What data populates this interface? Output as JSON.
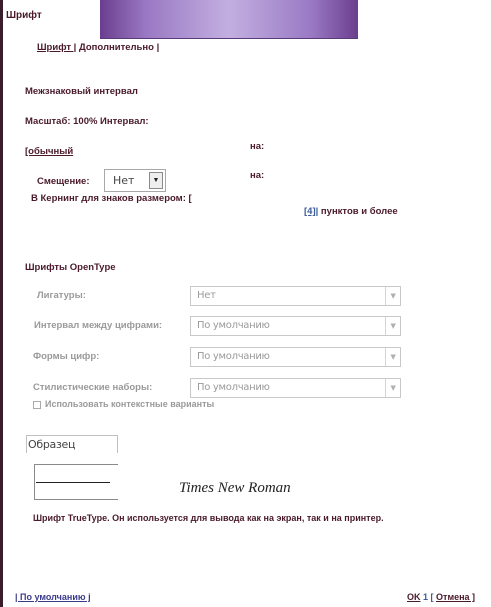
{
  "window": {
    "title": "Шрифт"
  },
  "tabs": {
    "font": "Шрифт |",
    "advanced": "Дополнительно |"
  },
  "spacing": {
    "heading": "Межзнаковый интервал",
    "scale_line": "Масштаб: 100% Интервал:",
    "spacing_value": "[обычный",
    "on_label_1": "на:",
    "offset_label": "Смещение:",
    "offset_value": "Нет",
    "on_label_2": "на:",
    "kerning_label": "В Кернинг для знаков размером: [",
    "kerning_value": "[4]|",
    "kerning_suffix": "пунктов и более"
  },
  "opentype": {
    "heading": "Шрифты OpenType",
    "rows": [
      {
        "label": "Лигатуры:",
        "value": "Нет"
      },
      {
        "label": "Интервал между цифрами:",
        "value": "По умолчанию"
      },
      {
        "label": "Формы цифр:",
        "value": "По умолчанию"
      },
      {
        "label": "Стилистические наборы:",
        "value": "По умолчанию"
      }
    ],
    "contextual_checkbox": "Использовать контекстные варианты"
  },
  "preview": {
    "label": "Образец",
    "sample_text": "Times New Roman",
    "description": "Шрифт TrueType. Он используется для вывода как на экран, так и на принтер."
  },
  "footer": {
    "default_button": "| По умолчанию j",
    "ok_button": "OK",
    "separator": "1 [",
    "cancel_button": "Отмена ]"
  },
  "colors": {
    "title_gradient": "#9a79c4",
    "text": "#4a1a2c",
    "link_blue": "#3b5b9a"
  }
}
